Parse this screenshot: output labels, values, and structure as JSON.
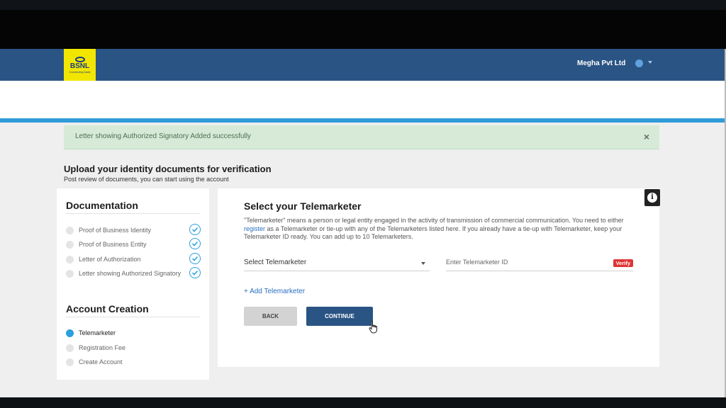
{
  "header": {
    "logo_name": "BSNL",
    "logo_tagline": "Connecting India",
    "company_name": "Megha Pvt Ltd",
    "user_icon": "user-icon",
    "brand_color": "#2a5484"
  },
  "alert": {
    "message": "Letter showing Authorized Signatory Added successfully",
    "close_label": "×"
  },
  "page": {
    "title": "Upload your identity documents for verification",
    "subtitle": "Post review of documents, you can start using the account"
  },
  "sidebar": {
    "documentation_heading": "Documentation",
    "documentation_items": [
      {
        "label": "Proof of Business Identity",
        "done": true
      },
      {
        "label": "Proof of Business Entity",
        "done": true
      },
      {
        "label": "Letter of Authorization",
        "done": true
      },
      {
        "label": "Letter showing Authorized Signatory",
        "done": true
      }
    ],
    "account_heading": "Account Creation",
    "account_items": [
      {
        "label": "Telemarketer",
        "active": true
      },
      {
        "label": "Registration Fee",
        "active": false
      },
      {
        "label": "Create Account",
        "active": false
      }
    ]
  },
  "main": {
    "title": "Select your Telemarketer",
    "desc_part1": "\"Telemarketer\" means a person or legal entity engaged in the activity of transmission of commercial communication. You need to either ",
    "desc_link": "register",
    "desc_part2": " as a Telemarketer or tie-up with any of the Telemarketers listed here. If you already have a tie-up with Telemarketer, keep your Telemarketer ID ready. You can add up to 10 Telemarketers.",
    "select_value": "Select Telemarketer",
    "id_placeholder": "Enter Telemarketer ID",
    "verify_label": "Verify",
    "add_label": "+ Add Telemarketer",
    "back_label": "BACK",
    "continue_label": "CONTINUE",
    "info_label": "i"
  }
}
